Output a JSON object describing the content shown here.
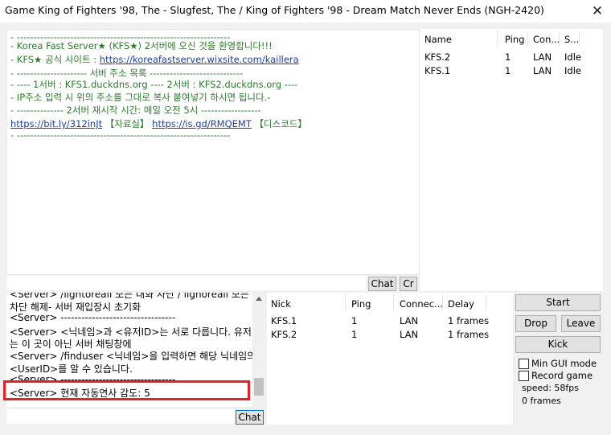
{
  "window": {
    "title": "Game King of Fighters '98, The - Slugfest, The / King of Fighters '98 - Dream Match Never Ends (NGH-2420)",
    "close": "✕"
  },
  "messages": {
    "l1": "- ----------------------------------------------------------------",
    "l2a": "- Korea Fast Server★ (KFS★) 2서버에 오신 것을 환영합니다!!!",
    "l3a": "- KFS★ 공식 사이트 : ",
    "l3link": "https://koreafastserver.wixsite.com/kaillera",
    "l4": "- --------------------- 서버 주소 목록 ----------------------------",
    "l5": "- ---- 1서버 : KFS1.duckdns.org ---- 2서버 : KFS2.duckdns.org ----",
    "l6": "- IP주소 입력 시 위의 주소를 그대로 복사 붙여넣기 하시면 됩니다.-",
    "l7": "- -------------- 2서버 재시작 시간: 매일 오전 5시 ------------------",
    "l8link1": "https://bit.ly/312inJt",
    "l8mid": " 【자료실】 ",
    "l8link2": "https://is.gd/RMQEMT",
    "l8end": " 【디스코드】",
    "l9": "- ----------------------------------------------------------------"
  },
  "top_buttons": {
    "chat": "Chat",
    "cr": "Cr"
  },
  "game_list": {
    "headers": [
      "Name",
      "Ping",
      "Con...",
      "S..."
    ],
    "rows": [
      [
        "KFS.2",
        "1",
        "LAN",
        "Idle"
      ],
      [
        "KFS.1",
        "1",
        "LAN",
        "Idle"
      ]
    ]
  },
  "server_messages": {
    "s0": "<Server> /lightoreall 모든 대화 차단 / lighoreall 모든 대화",
    "s1": "차단 해제- 서버 재입장시 초기화",
    "s2": "<Server> ---------------------------------",
    "s3": "<Server> <닉네임>과 <유저ID>는 서로 다릅니다. 유저ID",
    "s4": "는 이 곳이 아닌 서버 채팅창에",
    "s5": "<Server> /finduser <닉네임>을 입력하면 해당 닉네임의",
    "s6": "<UserID>를 알 수 있습니다.",
    "s7": "<Server> ---------------------------------",
    "s8": "<Server> 현재 자동연사 감도: 5"
  },
  "bottom_chat_button": "Chat",
  "user_list": {
    "headers": [
      "Nick",
      "Ping",
      "Connec...",
      "Delay"
    ],
    "rows": [
      [
        "KFS.1",
        "1",
        "LAN",
        "1 frames"
      ],
      [
        "KFS.2",
        "1",
        "LAN",
        "1 frames"
      ]
    ]
  },
  "controls": {
    "start": "Start",
    "drop": "Drop",
    "leave": "Leave",
    "kick": "Kick",
    "min_gui": "Min GUI mode",
    "record": "Record game",
    "speed": "speed: 58fps",
    "frames": "0 frames"
  },
  "colors": {
    "highlight_box": "#e0232a",
    "link": "#1f3f9f",
    "message_text": "#2a7a2a"
  }
}
